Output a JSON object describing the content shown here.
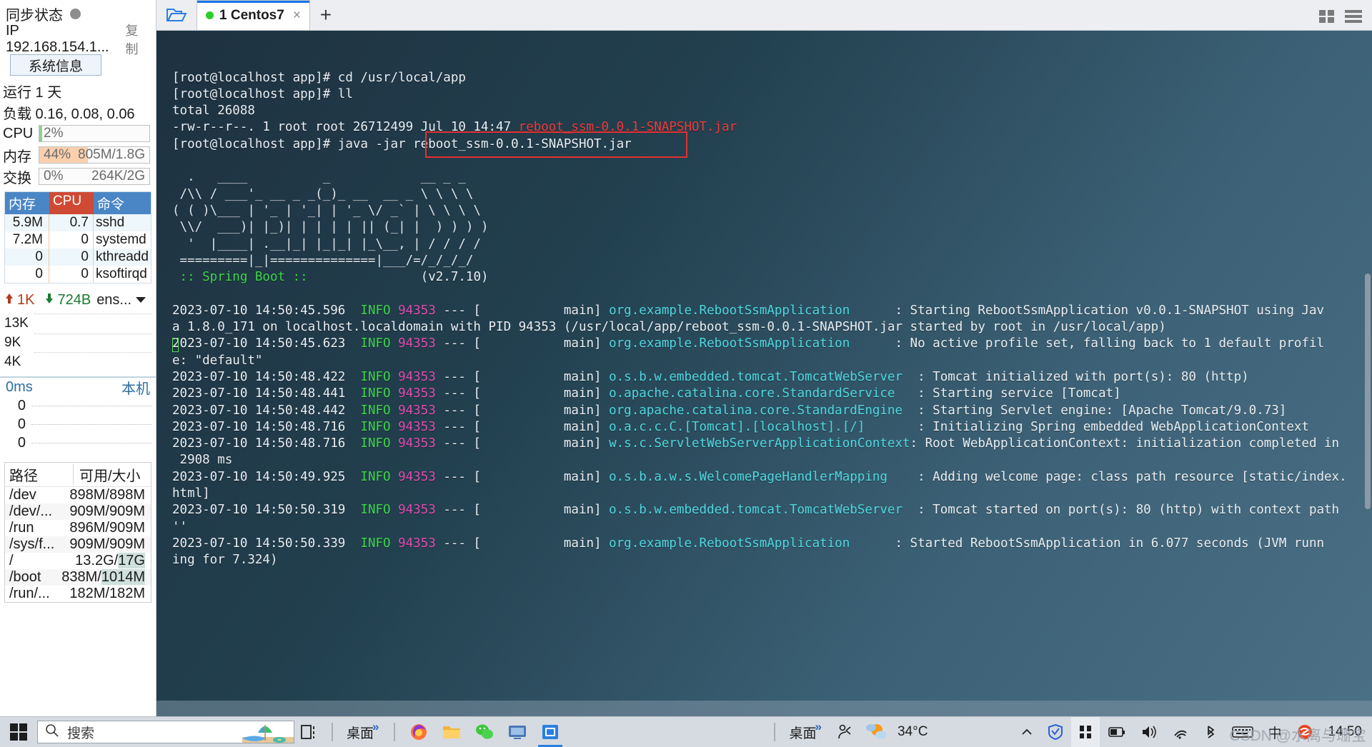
{
  "sidebar": {
    "sync_label": "同步状态",
    "ip_label": "IP 192.168.154.1...",
    "copy_label": "复制",
    "sysinfo_button": "系统信息",
    "uptime": "运行 1 天",
    "load": "负载 0.16, 0.08, 0.06",
    "meters": [
      {
        "name": "CPU",
        "pct_text": "2%",
        "detail": "",
        "fill_pct": 2,
        "fill_color": "#ffffff",
        "edge_color": "#8fd08f"
      },
      {
        "name": "内存",
        "pct_text": "44%",
        "detail": "805M/1.8G",
        "fill_pct": 44,
        "fill_color": "#fbd0ae",
        "edge_color": "#fbd0ae"
      },
      {
        "name": "交换",
        "pct_text": "0%",
        "detail": "264K/2G",
        "fill_pct": 0,
        "fill_color": "#ffffff",
        "edge_color": "#cccccc"
      }
    ],
    "proc_table": {
      "headers": [
        "内存",
        "CPU",
        "命令"
      ],
      "rows": [
        {
          "mem": "5.9M",
          "cpu": "0.7",
          "cmd": "sshd"
        },
        {
          "mem": "7.2M",
          "cpu": "0",
          "cmd": "systemd"
        },
        {
          "mem": "0",
          "cpu": "0",
          "cmd": "kthreadd"
        },
        {
          "mem": "0",
          "cpu": "0",
          "cmd": "ksoftirqd"
        }
      ]
    },
    "network": {
      "up_value": "1K",
      "down_value": "724B",
      "interface": "ens...",
      "y_ticks": [
        "13K",
        "9K",
        "4K"
      ]
    },
    "latency": {
      "value": "0ms",
      "host_label": "本机",
      "rows": [
        "0",
        "0",
        "0"
      ]
    },
    "disk_table": {
      "headers": [
        "路径",
        "可用/大小"
      ],
      "rows": [
        {
          "path": "/dev",
          "size": "898M/898M",
          "highlight": false
        },
        {
          "path": "/dev/...",
          "size": "909M/909M",
          "highlight": false
        },
        {
          "path": "/run",
          "size": "896M/909M",
          "highlight": false
        },
        {
          "path": "/sys/f...",
          "size": "909M/909M",
          "highlight": false
        },
        {
          "path": "/",
          "size": "13.2G/17G",
          "highlight": true
        },
        {
          "path": "/boot",
          "size": "838M/1014M",
          "highlight": true
        },
        {
          "path": "/run/...",
          "size": "182M/182M",
          "highlight": false
        }
      ]
    }
  },
  "terminal": {
    "tab_label": "1 Centos7",
    "tab_close": "×",
    "new_tab": "+",
    "folder_icon": "open-folder-icon",
    "grid_icon": "grid-view-icon",
    "menu_icon": "hamburger-menu-icon",
    "highlight_command": "java -jar reboot_ssm-0.0.1-SNAPSHOT.jar",
    "lines": [
      {
        "segments": [
          {
            "t": "[root@localhost app]# cd /usr/local/app"
          }
        ]
      },
      {
        "segments": [
          {
            "t": "[root@localhost app]# ll"
          }
        ]
      },
      {
        "segments": [
          {
            "t": "total 26088"
          }
        ]
      },
      {
        "segments": [
          {
            "t": "-rw-r--r--. 1 root root 26712499 Jul 10 14:47 "
          },
          {
            "t": "reboot_ssm-0.0.1-SNAPSHOT.jar",
            "c": "c-red"
          }
        ]
      },
      {
        "segments": [
          {
            "t": "[root@localhost app]# java -jar reboot_ssm-0.0.1-SNAPSHOT.jar"
          }
        ]
      },
      {
        "segments": [
          {
            "t": ""
          }
        ]
      },
      {
        "segments": [
          {
            "t": "  .   ____          _            __ _ _",
            "c": "c-ban"
          }
        ]
      },
      {
        "segments": [
          {
            "t": " /\\\\ / ___'_ __ _ _(_)_ __  __ _ \\ \\ \\ \\",
            "c": "c-ban"
          }
        ]
      },
      {
        "segments": [
          {
            "t": "( ( )\\___ | '_ | '_| | '_ \\/ _` | \\ \\ \\ \\",
            "c": "c-ban"
          }
        ]
      },
      {
        "segments": [
          {
            "t": " \\\\/  ___)| |_)| | | | | || (_| |  ) ) ) )",
            "c": "c-ban"
          }
        ]
      },
      {
        "segments": [
          {
            "t": "  '  |____| .__|_| |_|_| |_\\__, | / / / /",
            "c": "c-ban"
          }
        ]
      },
      {
        "segments": [
          {
            "t": " =========|_|==============|___/=/_/_/_/",
            "c": "c-ban"
          }
        ]
      },
      {
        "segments": [
          {
            "t": " :: Spring Boot :: ",
            "c": "c-green"
          },
          {
            "t": "              (v2.7.10)"
          }
        ]
      },
      {
        "segments": [
          {
            "t": ""
          }
        ]
      },
      {
        "segments": [
          {
            "t": "2023-07-10 14:50:45.596  "
          },
          {
            "t": "INFO ",
            "c": "c-green"
          },
          {
            "t": "94353",
            "c": "c-mag"
          },
          {
            "t": " --- [           main] "
          },
          {
            "t": "org.example.RebootSsmApplication",
            "c": "c-cyan"
          },
          {
            "t": "      : Starting RebootSsmApplication v0.0.1-SNAPSHOT using Jav"
          }
        ]
      },
      {
        "segments": [
          {
            "t": "a 1.8.0_171 on localhost.localdomain with PID 94353 (/usr/local/app/reboot_ssm-0.0.1-SNAPSHOT.jar started by root in /usr/local/app)"
          }
        ]
      },
      {
        "segments": [
          {
            "t": "2023-07-10 14:50:45.623  "
          },
          {
            "t": "INFO ",
            "c": "c-green"
          },
          {
            "t": "94353",
            "c": "c-mag"
          },
          {
            "t": " --- [           main] "
          },
          {
            "t": "org.example.RebootSsmApplication",
            "c": "c-cyan"
          },
          {
            "t": "      : No active profile set, falling back to 1 default profil"
          }
        ]
      },
      {
        "segments": [
          {
            "t": "e: \"default\""
          }
        ]
      },
      {
        "segments": [
          {
            "t": "2023-07-10 14:50:48.422  "
          },
          {
            "t": "INFO ",
            "c": "c-green"
          },
          {
            "t": "94353",
            "c": "c-mag"
          },
          {
            "t": " --- [           main] "
          },
          {
            "t": "o.s.b.w.embedded.tomcat.TomcatWebServer",
            "c": "c-cyan"
          },
          {
            "t": "  : Tomcat initialized with port(s): 80 (http)"
          }
        ]
      },
      {
        "segments": [
          {
            "t": "2023-07-10 14:50:48.441  "
          },
          {
            "t": "INFO ",
            "c": "c-green"
          },
          {
            "t": "94353",
            "c": "c-mag"
          },
          {
            "t": " --- [           main] "
          },
          {
            "t": "o.apache.catalina.core.StandardService",
            "c": "c-cyan"
          },
          {
            "t": "   : Starting service [Tomcat]"
          }
        ]
      },
      {
        "segments": [
          {
            "t": "2023-07-10 14:50:48.442  "
          },
          {
            "t": "INFO ",
            "c": "c-green"
          },
          {
            "t": "94353",
            "c": "c-mag"
          },
          {
            "t": " --- [           main] "
          },
          {
            "t": "org.apache.catalina.core.StandardEngine",
            "c": "c-cyan"
          },
          {
            "t": "  : Starting Servlet engine: [Apache Tomcat/9.0.73]"
          }
        ]
      },
      {
        "segments": [
          {
            "t": "2023-07-10 14:50:48.716  "
          },
          {
            "t": "INFO ",
            "c": "c-green"
          },
          {
            "t": "94353",
            "c": "c-mag"
          },
          {
            "t": " --- [           main] "
          },
          {
            "t": "o.a.c.c.C.[Tomcat].[localhost].[/]",
            "c": "c-cyan"
          },
          {
            "t": "       : Initializing Spring embedded WebApplicationContext"
          }
        ]
      },
      {
        "segments": [
          {
            "t": "2023-07-10 14:50:48.716  "
          },
          {
            "t": "INFO ",
            "c": "c-green"
          },
          {
            "t": "94353",
            "c": "c-mag"
          },
          {
            "t": " --- [           main] "
          },
          {
            "t": "w.s.c.ServletWebServerApplicationContext",
            "c": "c-cyan"
          },
          {
            "t": ": Root WebApplicationContext: initialization completed in"
          }
        ]
      },
      {
        "segments": [
          {
            "t": " 2908 ms"
          }
        ]
      },
      {
        "segments": [
          {
            "t": "2023-07-10 14:50:49.925  "
          },
          {
            "t": "INFO ",
            "c": "c-green"
          },
          {
            "t": "94353",
            "c": "c-mag"
          },
          {
            "t": " --- [           main] "
          },
          {
            "t": "o.s.b.a.w.s.WelcomePageHandlerMapping",
            "c": "c-cyan"
          },
          {
            "t": "    : Adding welcome page: class path resource [static/index."
          }
        ]
      },
      {
        "segments": [
          {
            "t": "html]"
          }
        ]
      },
      {
        "segments": [
          {
            "t": "2023-07-10 14:50:50.319  "
          },
          {
            "t": "INFO ",
            "c": "c-green"
          },
          {
            "t": "94353",
            "c": "c-mag"
          },
          {
            "t": " --- [           main] "
          },
          {
            "t": "o.s.b.w.embedded.tomcat.TomcatWebServer",
            "c": "c-cyan"
          },
          {
            "t": "  : Tomcat started on port(s): 80 (http) with context path"
          }
        ]
      },
      {
        "segments": [
          {
            "t": "''"
          }
        ]
      },
      {
        "segments": [
          {
            "t": "2023-07-10 14:50:50.339  "
          },
          {
            "t": "INFO ",
            "c": "c-green"
          },
          {
            "t": "94353",
            "c": "c-mag"
          },
          {
            "t": " --- [           main] "
          },
          {
            "t": "org.example.RebootSsmApplication",
            "c": "c-cyan"
          },
          {
            "t": "      : Started RebootSsmApplication in 6.077 seconds (JVM runn"
          }
        ]
      },
      {
        "segments": [
          {
            "t": "ing for 7.324)"
          }
        ]
      }
    ]
  },
  "taskbar": {
    "start_icon": "windows-start-icon",
    "search_placeholder": "搜索",
    "search_icon": "search-icon",
    "taskview_icon": "task-view-icon",
    "desktop_label_1": "桌面",
    "desktop_label_2": "桌面",
    "overflow_chevron": "»",
    "people_icon": "people-icon",
    "weather_icon": "cloudy-sun-icon",
    "temperature": "34°C",
    "show_hidden_icon": "chevron-up-icon",
    "shield_icon": "security-shield-icon",
    "net_icon": "network-icon",
    "battery_icon": "battery-icon",
    "volume_icon": "speaker-icon",
    "wifi_icon": "wifi-icon",
    "bluetooth_icon": "bluetooth-icon",
    "keyboard_icon": "keyboard-icon",
    "ime_label": "中",
    "sogou_icon": "sogou-ime-icon",
    "clock_time": "14:50",
    "watermark": "CSDN @水离与珊宝"
  }
}
